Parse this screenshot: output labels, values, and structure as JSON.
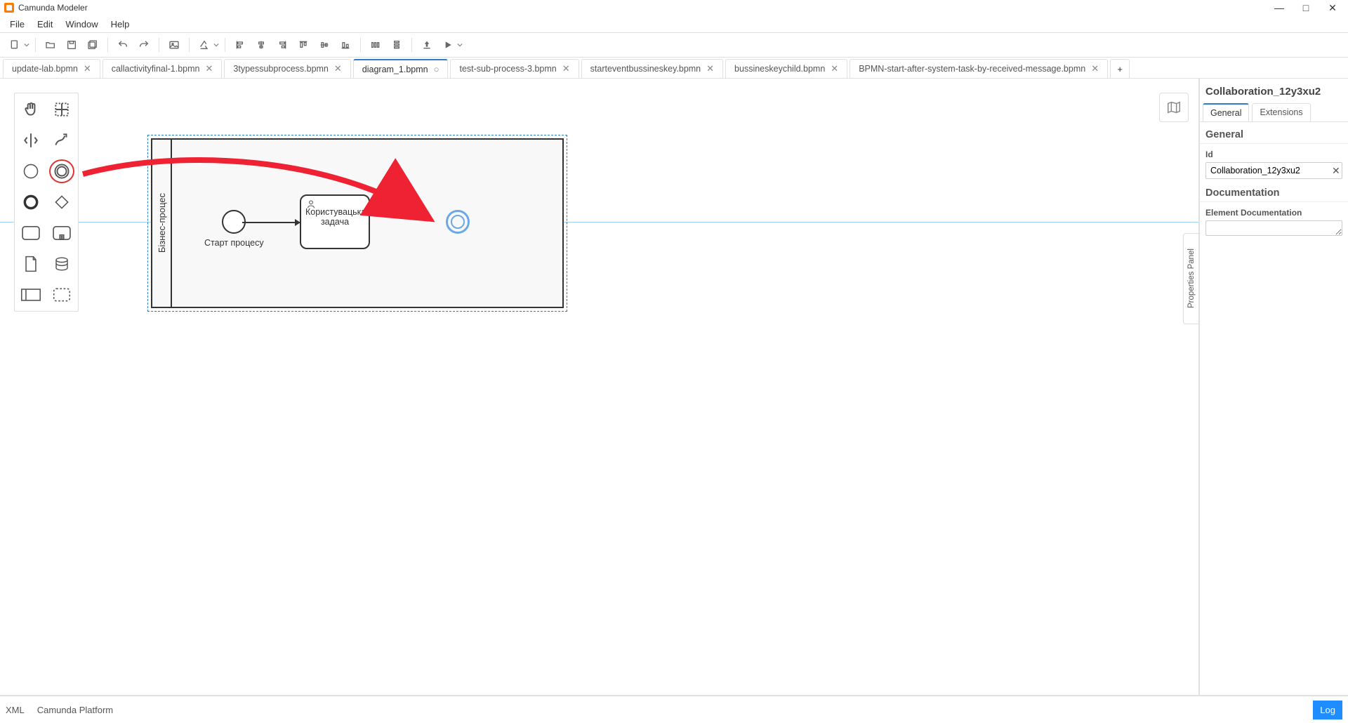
{
  "app": {
    "title": "Camunda Modeler"
  },
  "window_buttons": {
    "min": "—",
    "max": "□",
    "close": "✕"
  },
  "menu": {
    "file": "File",
    "edit": "Edit",
    "window": "Window",
    "help": "Help"
  },
  "tabs": [
    {
      "label": "update-lab.bpmn",
      "active": false,
      "dirty": false
    },
    {
      "label": "callactivityfinal-1.bpmn",
      "active": false,
      "dirty": false
    },
    {
      "label": "3typessubprocess.bpmn",
      "active": false,
      "dirty": false
    },
    {
      "label": "diagram_1.bpmn",
      "active": true,
      "dirty": true
    },
    {
      "label": "test-sub-process-3.bpmn",
      "active": false,
      "dirty": false
    },
    {
      "label": "starteventbussineskey.bpmn",
      "active": false,
      "dirty": false
    },
    {
      "label": "bussineskeychild.bpmn",
      "active": false,
      "dirty": false
    },
    {
      "label": "BPMN-start-after-system-task-by-received-message.bpmn",
      "active": false,
      "dirty": false
    }
  ],
  "diagram": {
    "pool_label": "Бізнес-процес",
    "start_event_label": "Старт процесу",
    "user_task_line1": "Користувацька",
    "user_task_line2": "задача"
  },
  "properties": {
    "title": "Collaboration_12y3xu2",
    "tab_general": "General",
    "tab_extensions": "Extensions",
    "section_general": "General",
    "id_label": "Id",
    "id_value": "Collaboration_12y3xu2",
    "section_doc": "Documentation",
    "doc_label": "Element Documentation",
    "toggle_label": "Properties Panel"
  },
  "footer": {
    "xml": "XML",
    "platform": "Camunda Platform",
    "log": "Log"
  }
}
